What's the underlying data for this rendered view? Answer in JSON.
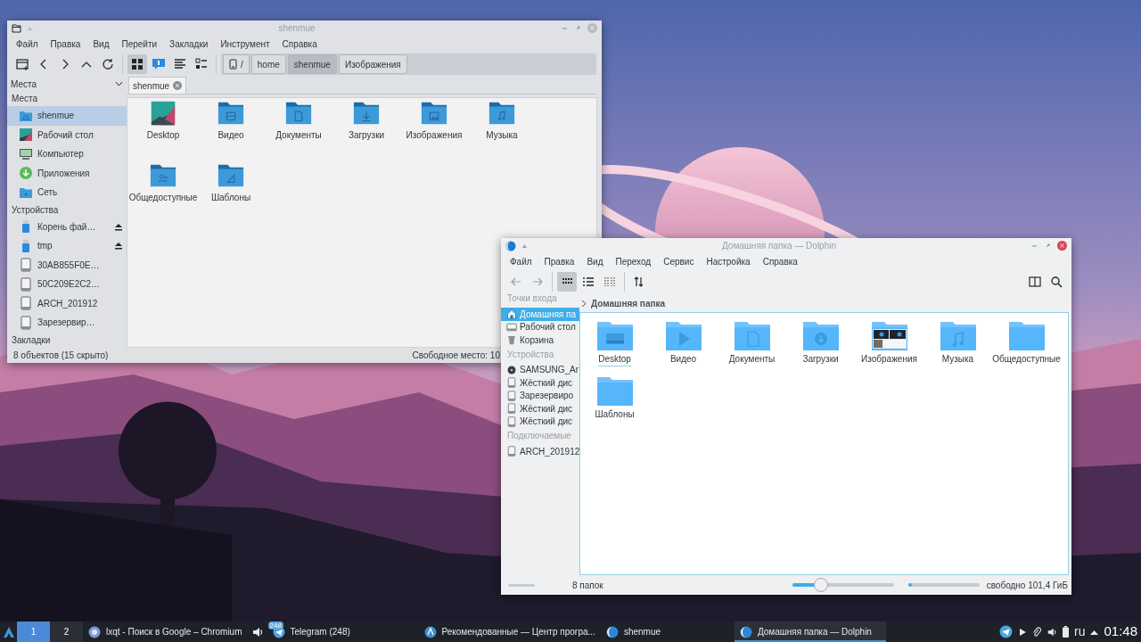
{
  "file_manager": {
    "title": "shenmue",
    "menu": [
      "Файл",
      "Правка",
      "Вид",
      "Перейти",
      "Закладки",
      "Инструмент",
      "Справка"
    ],
    "view_modes": [
      {
        "kind": "icons",
        "selected": true
      },
      {
        "kind": "thumbnails",
        "selected": false
      },
      {
        "kind": "list",
        "selected": false
      },
      {
        "kind": "compact",
        "selected": false
      }
    ],
    "path": [
      {
        "label": "/",
        "kind": "root",
        "selected": false
      },
      {
        "label": "home",
        "kind": "dir",
        "selected": false
      },
      {
        "label": "shenmue",
        "kind": "dir",
        "selected": true
      },
      {
        "label": "Изображения",
        "kind": "dir",
        "selected": false
      }
    ],
    "side_pane": "Места",
    "tabs": [
      {
        "label": "shenmue",
        "selected": true
      }
    ],
    "sidebar": [
      {
        "title": "Места",
        "items": [
          {
            "label": "shenmue",
            "kind": "home",
            "selected": true,
            "ejectable": false
          },
          {
            "label": "Рабочий стол",
            "kind": "desktop",
            "selected": false,
            "ejectable": false
          },
          {
            "label": "Компьютер",
            "kind": "computer",
            "selected": false,
            "ejectable": false
          },
          {
            "label": "Приложения",
            "kind": "apps",
            "selected": false,
            "ejectable": false
          },
          {
            "label": "Сеть",
            "kind": "network",
            "selected": false,
            "ejectable": false
          }
        ]
      },
      {
        "title": "Устройства",
        "items": [
          {
            "label": "Корень фай…",
            "kind": "usb",
            "selected": false,
            "ejectable": true
          },
          {
            "label": "tmp",
            "kind": "usb",
            "selected": false,
            "ejectable": true
          },
          {
            "label": "30AB855F0E…",
            "kind": "drive",
            "selected": false,
            "ejectable": false
          },
          {
            "label": "50C209E2C2…",
            "kind": "drive",
            "selected": false,
            "ejectable": false
          },
          {
            "label": "ARCH_201912",
            "kind": "drive",
            "selected": false,
            "ejectable": false
          },
          {
            "label": "Зарезервир…",
            "kind": "drive",
            "selected": false,
            "ejectable": false
          }
        ]
      },
      {
        "title": "Закладки"
      }
    ],
    "files": [
      {
        "name": "Desktop",
        "kind": "desktop"
      },
      {
        "name": "Видео",
        "kind": "video"
      },
      {
        "name": "Документы",
        "kind": "documents"
      },
      {
        "name": "Загрузки",
        "kind": "downloads"
      },
      {
        "name": "Изображения",
        "kind": "pictures"
      },
      {
        "name": "Музыка",
        "kind": "music"
      },
      {
        "name": "Общедоступные",
        "kind": "public"
      },
      {
        "name": "Шаблоны",
        "kind": "templates"
      }
    ],
    "status": "8 объектов (15 скрыто)",
    "free_space": "Свободное место: 10"
  },
  "dolphin": {
    "title": "Домашняя папка — Dolphin",
    "menu": [
      "Файл",
      "Правка",
      "Вид",
      "Переход",
      "Сервис",
      "Настройка",
      "Справка"
    ],
    "view_modes": [
      {
        "kind": "icons",
        "selected": true
      },
      {
        "kind": "details",
        "selected": false
      },
      {
        "kind": "compact",
        "selected": false
      }
    ],
    "sidebar": [
      {
        "title": "Точки входа",
        "items": [
          {
            "label": "Домашняя па",
            "kind": "home",
            "selected": true
          },
          {
            "label": "Рабочий стол",
            "kind": "desktop",
            "selected": false
          },
          {
            "label": "Корзина",
            "kind": "trash",
            "selected": false
          }
        ]
      },
      {
        "title": "Устройства",
        "items": [
          {
            "label": "SAMSUNG_Ar",
            "kind": "optical",
            "selected": false
          },
          {
            "label": "Жёсткий дис",
            "kind": "drive",
            "selected": false
          },
          {
            "label": "Зарезервиро",
            "kind": "drive",
            "selected": false
          },
          {
            "label": "Жёсткий дис",
            "kind": "drive",
            "selected": false
          },
          {
            "label": "Жёсткий дис",
            "kind": "drive",
            "selected": false
          }
        ]
      },
      {
        "title": "Подключаемые",
        "items": [
          {
            "label": "ARCH_201912",
            "kind": "drive",
            "selected": false
          }
        ]
      }
    ],
    "breadcrumb": "Домашняя папка",
    "files": [
      {
        "name": "Desktop",
        "kind": "desktop",
        "focused": true
      },
      {
        "name": "Видео",
        "kind": "video",
        "focused": false
      },
      {
        "name": "Документы",
        "kind": "documents",
        "focused": false
      },
      {
        "name": "Загрузки",
        "kind": "downloads",
        "focused": false
      },
      {
        "name": "Изображения",
        "kind": "preview",
        "focused": false
      },
      {
        "name": "Музыка",
        "kind": "music",
        "focused": false
      },
      {
        "name": "Общедоступные",
        "kind": "plain",
        "focused": false
      },
      {
        "name": "Шаблоны",
        "kind": "plain",
        "focused": false
      }
    ],
    "status": "8 папок",
    "zoom": {
      "level": 0.28
    },
    "free_space": {
      "level": 0.05,
      "text": "свободно 101,4 ГиБ"
    }
  },
  "taskbar": {
    "desktops": [
      {
        "label": "1",
        "selected": true
      },
      {
        "label": "2",
        "selected": false
      }
    ],
    "tasks": [
      {
        "label": "lxqt - Поиск в Google – Chromium",
        "kind": "chromium",
        "selected": false,
        "audio": true
      },
      {
        "label": "Telegram (248)",
        "kind": "telegram",
        "selected": false,
        "audio": false,
        "badge": "248"
      },
      {
        "label": "Рекомендованные — Центр програ...",
        "kind": "store",
        "selected": false,
        "audio": false
      },
      {
        "label": "shenmue",
        "kind": "dolphin",
        "selected": false,
        "audio": false
      },
      {
        "label": "Домашняя папка — Dolphin",
        "kind": "dolphin",
        "selected": true,
        "audio": false
      }
    ],
    "language": "ru",
    "clock": "01:48"
  }
}
